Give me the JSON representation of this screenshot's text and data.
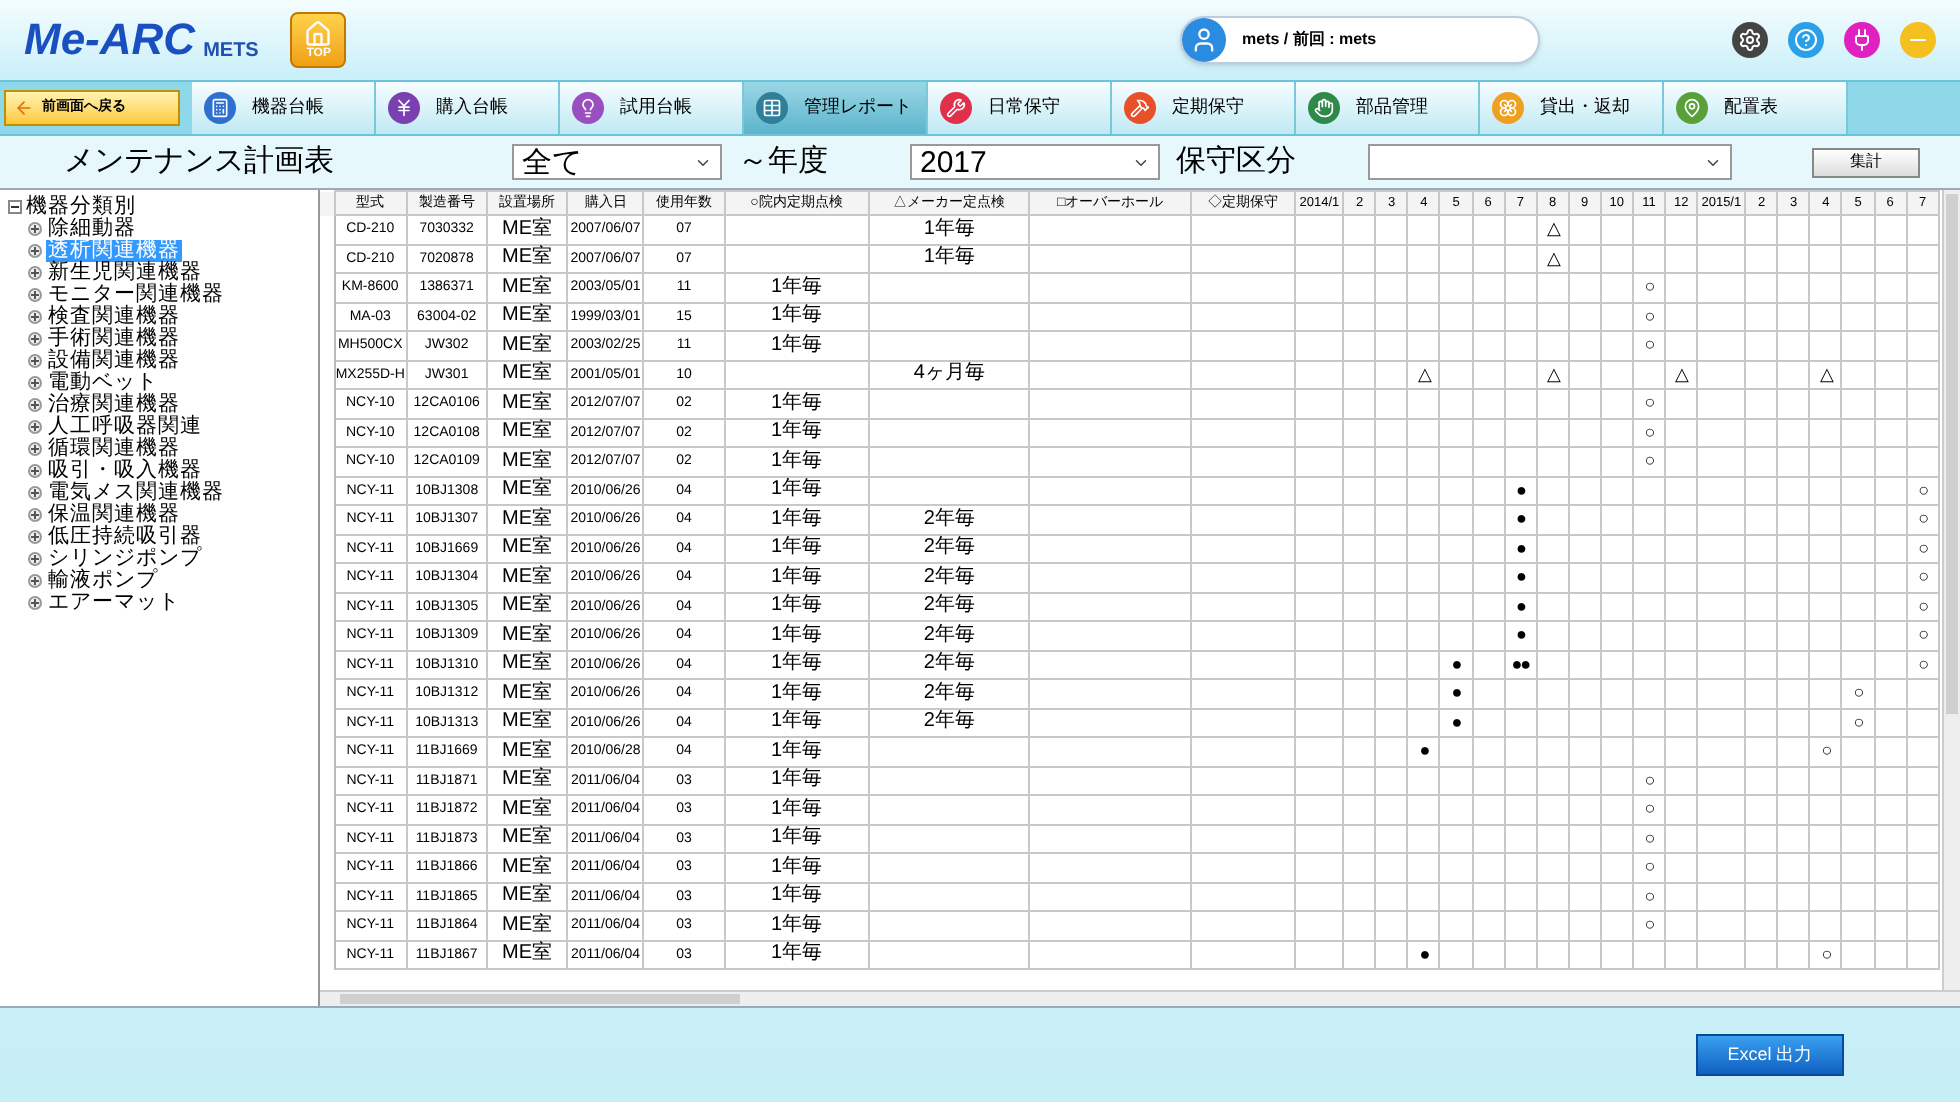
{
  "header": {
    "logo": "Me-ARC",
    "logo_sub": "METS",
    "top_button": "TOP",
    "user": "mets / 前回 : mets"
  },
  "nav": {
    "back": "前画面へ戻る",
    "tabs": [
      {
        "label": "機器台帳",
        "selected": false
      },
      {
        "label": "購入台帳",
        "selected": false
      },
      {
        "label": "試用台帳",
        "selected": false
      },
      {
        "label": "管理レポート",
        "selected": true
      },
      {
        "label": "日常保守",
        "selected": false
      },
      {
        "label": "定期保守",
        "selected": false
      },
      {
        "label": "部品管理",
        "selected": false
      },
      {
        "label": "貸出・返却",
        "selected": false
      },
      {
        "label": "配置表",
        "selected": false
      }
    ]
  },
  "toolbar": {
    "title": "メンテナンス計画表",
    "category": "全て",
    "year_suffix": "～年度",
    "year": "2017",
    "type_label": "保守区分",
    "run": "集計"
  },
  "tree": {
    "label": "機器分類別",
    "expanded": true,
    "children": [
      {
        "label": "除細動器",
        "selected": false
      },
      {
        "label": "透析関連機器",
        "selected": true
      },
      {
        "label": "新生児関連機器",
        "selected": false
      },
      {
        "label": "モニター関連機器",
        "selected": false
      },
      {
        "label": "検査関連機器",
        "selected": false
      },
      {
        "label": "手術関連機器",
        "selected": false
      },
      {
        "label": "設備関連機器",
        "selected": false
      },
      {
        "label": "電動ベット",
        "selected": false
      },
      {
        "label": "治療関連機器",
        "selected": false
      },
      {
        "label": "人工呼吸器関連",
        "selected": false
      },
      {
        "label": "循環関連機器",
        "selected": false
      },
      {
        "label": "吸引・吸入機器",
        "selected": false
      },
      {
        "label": "電気メス関連機器",
        "selected": false
      },
      {
        "label": "保温関連機器",
        "selected": false
      },
      {
        "label": "低圧持続吸引器",
        "selected": false
      },
      {
        "label": "シリンジポンプ",
        "selected": false
      },
      {
        "label": "輸液ポンプ",
        "selected": false
      },
      {
        "label": "エアーマット",
        "selected": false
      }
    ]
  },
  "table": {
    "columns": [
      "型式",
      "製造番号",
      "設置場所",
      "購入日",
      "使用年数",
      "○院内定期点検",
      "△メーカー定点検",
      "□オーバーホール",
      "◇定期保守"
    ],
    "months": [
      "2014/1",
      "2",
      "3",
      "4",
      "5",
      "6",
      "7",
      "8",
      "9",
      "10",
      "11",
      "12",
      "2015/1",
      "2",
      "3",
      "4",
      "5",
      "6",
      "7"
    ],
    "rows": [
      {
        "model": "CD-210",
        "serial": "7030332",
        "location": "ME室",
        "purchased": "2007/06/07",
        "years": "07",
        "maker": "1年毎",
        "months": [
          {
            "kind": "blank"
          },
          {
            "kind": "blank"
          },
          {
            "kind": "blank"
          },
          {
            "kind": "blank"
          },
          {
            "kind": "blank"
          },
          {
            "kind": "blank"
          },
          {
            "kind": "blank"
          },
          {
            "kind": "mark",
            "mark": "△"
          },
          {
            "kind": "blank"
          },
          {
            "kind": "blank"
          },
          {
            "kind": "blank"
          },
          {
            "kind": "blank"
          },
          {
            "kind": "blank"
          },
          {
            "kind": "blank"
          },
          {
            "kind": "blank"
          },
          {
            "kind": "blank"
          },
          {
            "kind": "blank"
          },
          {
            "kind": "blank"
          },
          {
            "kind": "blank"
          }
        ]
      },
      {
        "model": "CD-210",
        "serial": "7020878",
        "location": "ME室",
        "purchased": "2007/06/07",
        "years": "07",
        "maker": "1年毎",
        "months": [
          {
            "kind": "blank"
          },
          {
            "kind": "blank"
          },
          {
            "kind": "blank"
          },
          {
            "kind": "blank"
          },
          {
            "kind": "blank"
          },
          {
            "kind": "blank"
          },
          {
            "kind": "blank"
          },
          {
            "kind": "mark",
            "mark": "△"
          },
          {
            "kind": "blank"
          },
          {
            "kind": "blank"
          },
          {
            "kind": "blank"
          },
          {
            "kind": "blank"
          },
          {
            "kind": "blank"
          },
          {
            "kind": "blank"
          },
          {
            "kind": "blank"
          },
          {
            "kind": "blank"
          },
          {
            "kind": "blank"
          },
          {
            "kind": "blank"
          },
          {
            "kind": "blank"
          }
        ]
      },
      {
        "model": "KM-8600",
        "serial": "1386371",
        "location": "ME室",
        "purchased": "2003/05/01",
        "years": "11",
        "inhouse": "1年毎",
        "months": [
          {
            "kind": "blank"
          },
          {
            "kind": "blank"
          },
          {
            "kind": "blank"
          },
          {
            "kind": "blank"
          },
          {
            "kind": "blank"
          },
          {
            "kind": "blank"
          },
          {
            "kind": "blank"
          },
          {
            "kind": "blank"
          },
          {
            "kind": "blank"
          },
          {
            "kind": "blank"
          },
          {
            "kind": "mark",
            "mark": "○"
          },
          {
            "kind": "blank"
          },
          {
            "kind": "blank"
          },
          {
            "kind": "blank"
          },
          {
            "kind": "blank"
          },
          {
            "kind": "blank"
          },
          {
            "kind": "blank"
          },
          {
            "kind": "blank"
          },
          {
            "kind": "blank"
          }
        ]
      },
      {
        "model": "MA-03",
        "serial": "63004-02",
        "location": "ME室",
        "purchased": "1999/03/01",
        "years": "15",
        "inhouse": "1年毎",
        "months": [
          {
            "kind": "blank"
          },
          {
            "kind": "blank"
          },
          {
            "kind": "blank"
          },
          {
            "kind": "blank"
          },
          {
            "kind": "blank"
          },
          {
            "kind": "blank"
          },
          {
            "kind": "blank"
          },
          {
            "kind": "blank"
          },
          {
            "kind": "blank"
          },
          {
            "kind": "blank"
          },
          {
            "kind": "mark",
            "mark": "○"
          },
          {
            "kind": "blank"
          },
          {
            "kind": "blank"
          },
          {
            "kind": "blank"
          },
          {
            "kind": "blank"
          },
          {
            "kind": "blank"
          },
          {
            "kind": "blank"
          },
          {
            "kind": "blank"
          },
          {
            "kind": "blank"
          }
        ]
      },
      {
        "model": "MH500CX",
        "serial": "JW302",
        "location": "ME室",
        "purchased": "2003/02/25",
        "years": "11",
        "inhouse": "1年毎",
        "months": [
          {
            "kind": "blank"
          },
          {
            "kind": "blank"
          },
          {
            "kind": "blank"
          },
          {
            "kind": "blank"
          },
          {
            "kind": "blank"
          },
          {
            "kind": "blank"
          },
          {
            "kind": "blank"
          },
          {
            "kind": "blank"
          },
          {
            "kind": "blank"
          },
          {
            "kind": "blank"
          },
          {
            "kind": "mark",
            "mark": "○"
          },
          {
            "kind": "blank"
          },
          {
            "kind": "blank"
          },
          {
            "kind": "blank"
          },
          {
            "kind": "blank"
          },
          {
            "kind": "blank"
          },
          {
            "kind": "blank"
          },
          {
            "kind": "blank"
          },
          {
            "kind": "blank"
          }
        ]
      },
      {
        "model": "MX255D-H",
        "serial": "JW301",
        "location": "ME室",
        "purchased": "2001/05/01",
        "years": "10",
        "maker": "4ヶ月毎",
        "months": [
          {
            "kind": "blank"
          },
          {
            "kind": "blank"
          },
          {
            "kind": "blank"
          },
          {
            "kind": "mark",
            "mark": "△"
          },
          {
            "kind": "blank"
          },
          {
            "kind": "blank"
          },
          {
            "kind": "blank"
          },
          {
            "kind": "mark",
            "mark": "△"
          },
          {
            "kind": "blank"
          },
          {
            "kind": "blank"
          },
          {
            "kind": "blank"
          },
          {
            "kind": "mark",
            "mark": "△"
          },
          {
            "kind": "blank"
          },
          {
            "kind": "blank"
          },
          {
            "kind": "blank"
          },
          {
            "kind": "mark",
            "mark": "△"
          },
          {
            "kind": "blank"
          },
          {
            "kind": "blank"
          },
          {
            "kind": "blank"
          }
        ]
      },
      {
        "model": "NCY-10",
        "serial": "12CA0106",
        "location": "ME室",
        "purchased": "2012/07/07",
        "years": "02",
        "inhouse": "1年毎",
        "months": [
          {
            "kind": "blank"
          },
          {
            "kind": "blank"
          },
          {
            "kind": "blank"
          },
          {
            "kind": "blank"
          },
          {
            "kind": "blank"
          },
          {
            "kind": "blank"
          },
          {
            "kind": "blank"
          },
          {
            "kind": "blank"
          },
          {
            "kind": "blank"
          },
          {
            "kind": "blank"
          },
          {
            "kind": "mark",
            "mark": "○"
          },
          {
            "kind": "blank"
          },
          {
            "kind": "blank"
          },
          {
            "kind": "blank"
          },
          {
            "kind": "blank"
          },
          {
            "kind": "blank"
          },
          {
            "kind": "blank"
          },
          {
            "kind": "blank"
          },
          {
            "kind": "blank"
          }
        ]
      },
      {
        "model": "NCY-10",
        "serial": "12CA0108",
        "location": "ME室",
        "purchased": "2012/07/07",
        "years": "02",
        "inhouse": "1年毎",
        "months": [
          {
            "kind": "blank"
          },
          {
            "kind": "blank"
          },
          {
            "kind": "blank"
          },
          {
            "kind": "blank"
          },
          {
            "kind": "blank"
          },
          {
            "kind": "blank"
          },
          {
            "kind": "blank"
          },
          {
            "kind": "blank"
          },
          {
            "kind": "blank"
          },
          {
            "kind": "blank"
          },
          {
            "kind": "mark",
            "mark": "○"
          },
          {
            "kind": "blank"
          },
          {
            "kind": "blank"
          },
          {
            "kind": "blank"
          },
          {
            "kind": "blank"
          },
          {
            "kind": "blank"
          },
          {
            "kind": "blank"
          },
          {
            "kind": "blank"
          },
          {
            "kind": "blank"
          }
        ]
      },
      {
        "model": "NCY-10",
        "serial": "12CA0109",
        "location": "ME室",
        "purchased": "2012/07/07",
        "years": "02",
        "inhouse": "1年毎",
        "months": [
          {
            "kind": "blank"
          },
          {
            "kind": "blank"
          },
          {
            "kind": "blank"
          },
          {
            "kind": "blank"
          },
          {
            "kind": "blank"
          },
          {
            "kind": "blank"
          },
          {
            "kind": "blank"
          },
          {
            "kind": "blank"
          },
          {
            "kind": "blank"
          },
          {
            "kind": "blank"
          },
          {
            "kind": "mark",
            "mark": "○"
          },
          {
            "kind": "blank"
          },
          {
            "kind": "blank"
          },
          {
            "kind": "blank"
          },
          {
            "kind": "blank"
          },
          {
            "kind": "blank"
          },
          {
            "kind": "blank"
          },
          {
            "kind": "blank"
          },
          {
            "kind": "blank"
          }
        ]
      },
      {
        "model": "NCY-11",
        "serial": "10BJ1308",
        "location": "ME室",
        "purchased": "2010/06/26",
        "years": "04",
        "inhouse": "1年毎",
        "months": [
          {
            "kind": "blank"
          },
          {
            "kind": "blank"
          },
          {
            "kind": "blank"
          },
          {
            "kind": "blank"
          },
          {
            "kind": "blank"
          },
          {
            "kind": "blank"
          },
          {
            "kind": "mark",
            "mark": "●"
          },
          {
            "kind": "blank"
          },
          {
            "kind": "blank"
          },
          {
            "kind": "blank"
          },
          {
            "kind": "blank"
          },
          {
            "kind": "blank"
          },
          {
            "kind": "blank"
          },
          {
            "kind": "blank"
          },
          {
            "kind": "blank"
          },
          {
            "kind": "blank"
          },
          {
            "kind": "blank"
          },
          {
            "kind": "blank"
          },
          {
            "kind": "mark",
            "mark": "○"
          }
        ]
      },
      {
        "model": "NCY-11",
        "serial": "10BJ1307",
        "location": "ME室",
        "purchased": "2010/06/26",
        "years": "04",
        "inhouse": "1年毎",
        "maker": "2年毎",
        "months": [
          {
            "kind": "blank"
          },
          {
            "kind": "blank"
          },
          {
            "kind": "blank"
          },
          {
            "kind": "blank"
          },
          {
            "kind": "blank"
          },
          {
            "kind": "blank"
          },
          {
            "kind": "mark",
            "mark": "●"
          },
          {
            "kind": "blank"
          },
          {
            "kind": "blank"
          },
          {
            "kind": "blank"
          },
          {
            "kind": "blank"
          },
          {
            "kind": "blank"
          },
          {
            "kind": "blank"
          },
          {
            "kind": "blank"
          },
          {
            "kind": "blank"
          },
          {
            "kind": "blank"
          },
          {
            "kind": "blank"
          },
          {
            "kind": "blank"
          },
          {
            "kind": "mark",
            "mark": "○"
          }
        ]
      },
      {
        "model": "NCY-11",
        "serial": "10BJ1669",
        "location": "ME室",
        "purchased": "2010/06/26",
        "years": "04",
        "inhouse": "1年毎",
        "maker": "2年毎",
        "months": [
          {
            "kind": "blank"
          },
          {
            "kind": "blank"
          },
          {
            "kind": "blank"
          },
          {
            "kind": "blank"
          },
          {
            "kind": "blank"
          },
          {
            "kind": "blank"
          },
          {
            "kind": "mark",
            "mark": "●"
          },
          {
            "kind": "blank"
          },
          {
            "kind": "blank"
          },
          {
            "kind": "blank"
          },
          {
            "kind": "blank"
          },
          {
            "kind": "blank"
          },
          {
            "kind": "blank"
          },
          {
            "kind": "blank"
          },
          {
            "kind": "blank"
          },
          {
            "kind": "blank"
          },
          {
            "kind": "blank"
          },
          {
            "kind": "blank"
          },
          {
            "kind": "mark",
            "mark": "○"
          }
        ]
      },
      {
        "model": "NCY-11",
        "serial": "10BJ1304",
        "location": "ME室",
        "purchased": "2010/06/26",
        "years": "04",
        "inhouse": "1年毎",
        "maker": "2年毎",
        "months": [
          {
            "kind": "blank"
          },
          {
            "kind": "blank"
          },
          {
            "kind": "blank"
          },
          {
            "kind": "blank"
          },
          {
            "kind": "blank"
          },
          {
            "kind": "blank"
          },
          {
            "kind": "mark",
            "mark": "●"
          },
          {
            "kind": "blank"
          },
          {
            "kind": "blank"
          },
          {
            "kind": "blank"
          },
          {
            "kind": "blank"
          },
          {
            "kind": "blank"
          },
          {
            "kind": "blank"
          },
          {
            "kind": "blank"
          },
          {
            "kind": "blank"
          },
          {
            "kind": "blank"
          },
          {
            "kind": "blank"
          },
          {
            "kind": "blank"
          },
          {
            "kind": "mark",
            "mark": "○"
          }
        ]
      },
      {
        "model": "NCY-11",
        "serial": "10BJ1305",
        "location": "ME室",
        "purchased": "2010/06/26",
        "years": "04",
        "inhouse": "1年毎",
        "maker": "2年毎",
        "months": [
          {
            "kind": "blank"
          },
          {
            "kind": "blank"
          },
          {
            "kind": "blank"
          },
          {
            "kind": "blank"
          },
          {
            "kind": "blank"
          },
          {
            "kind": "blank"
          },
          {
            "kind": "mark",
            "mark": "●"
          },
          {
            "kind": "blank"
          },
          {
            "kind": "blank"
          },
          {
            "kind": "blank"
          },
          {
            "kind": "blank"
          },
          {
            "kind": "blank"
          },
          {
            "kind": "blank"
          },
          {
            "kind": "blank"
          },
          {
            "kind": "blank"
          },
          {
            "kind": "blank"
          },
          {
            "kind": "blank"
          },
          {
            "kind": "blank"
          },
          {
            "kind": "mark",
            "mark": "○"
          }
        ]
      },
      {
        "model": "NCY-11",
        "serial": "10BJ1309",
        "location": "ME室",
        "purchased": "2010/06/26",
        "years": "04",
        "inhouse": "1年毎",
        "maker": "2年毎",
        "months": [
          {
            "kind": "blank"
          },
          {
            "kind": "blank"
          },
          {
            "kind": "blank"
          },
          {
            "kind": "blank"
          },
          {
            "kind": "blank"
          },
          {
            "kind": "blank"
          },
          {
            "kind": "mark",
            "mark": "●"
          },
          {
            "kind": "blank"
          },
          {
            "kind": "blank"
          },
          {
            "kind": "blank"
          },
          {
            "kind": "blank"
          },
          {
            "kind": "blank"
          },
          {
            "kind": "blank"
          },
          {
            "kind": "blank"
          },
          {
            "kind": "blank"
          },
          {
            "kind": "blank"
          },
          {
            "kind": "blank"
          },
          {
            "kind": "blank"
          },
          {
            "kind": "mark",
            "mark": "○"
          }
        ]
      },
      {
        "model": "NCY-11",
        "serial": "10BJ1310",
        "location": "ME室",
        "purchased": "2010/06/26",
        "years": "04",
        "inhouse": "1年毎",
        "maker": "2年毎",
        "months": [
          {
            "kind": "blank"
          },
          {
            "kind": "blank"
          },
          {
            "kind": "blank"
          },
          {
            "kind": "blank"
          },
          {
            "kind": "mark",
            "mark": "●"
          },
          {
            "kind": "blank"
          },
          {
            "kind": "mark",
            "mark": "●●"
          },
          {
            "kind": "blank"
          },
          {
            "kind": "blank"
          },
          {
            "kind": "blank"
          },
          {
            "kind": "blank"
          },
          {
            "kind": "blank"
          },
          {
            "kind": "blank"
          },
          {
            "kind": "blank"
          },
          {
            "kind": "blank"
          },
          {
            "kind": "blank"
          },
          {
            "kind": "blank"
          },
          {
            "kind": "blank"
          },
          {
            "kind": "mark",
            "mark": "○"
          }
        ]
      },
      {
        "model": "NCY-11",
        "serial": "10BJ1312",
        "location": "ME室",
        "purchased": "2010/06/26",
        "years": "04",
        "inhouse": "1年毎",
        "maker": "2年毎",
        "months": [
          {
            "kind": "blank"
          },
          {
            "kind": "blank"
          },
          {
            "kind": "blank"
          },
          {
            "kind": "blank"
          },
          {
            "kind": "mark",
            "mark": "●"
          },
          {
            "kind": "blank"
          },
          {
            "kind": "blank"
          },
          {
            "kind": "blank"
          },
          {
            "kind": "blank"
          },
          {
            "kind": "blank"
          },
          {
            "kind": "blank"
          },
          {
            "kind": "blank"
          },
          {
            "kind": "blank"
          },
          {
            "kind": "blank"
          },
          {
            "kind": "blank"
          },
          {
            "kind": "blank"
          },
          {
            "kind": "mark",
            "mark": "○"
          },
          {
            "kind": "blank"
          },
          {
            "kind": "blank"
          }
        ]
      },
      {
        "model": "NCY-11",
        "serial": "10BJ1313",
        "location": "ME室",
        "purchased": "2010/06/26",
        "years": "04",
        "inhouse": "1年毎",
        "maker": "2年毎",
        "months": [
          {
            "kind": "blank"
          },
          {
            "kind": "blank"
          },
          {
            "kind": "blank"
          },
          {
            "kind": "blank"
          },
          {
            "kind": "mark",
            "mark": "●"
          },
          {
            "kind": "blank"
          },
          {
            "kind": "blank"
          },
          {
            "kind": "blank"
          },
          {
            "kind": "blank"
          },
          {
            "kind": "blank"
          },
          {
            "kind": "blank"
          },
          {
            "kind": "blank"
          },
          {
            "kind": "blank"
          },
          {
            "kind": "blank"
          },
          {
            "kind": "blank"
          },
          {
            "kind": "blank"
          },
          {
            "kind": "mark",
            "mark": "○"
          },
          {
            "kind": "blank"
          },
          {
            "kind": "blank"
          }
        ]
      },
      {
        "model": "NCY-11",
        "serial": "11BJ1669",
        "location": "ME室",
        "purchased": "2010/06/28",
        "years": "04",
        "inhouse": "1年毎",
        "months": [
          {
            "kind": "blank"
          },
          {
            "kind": "blank"
          },
          {
            "kind": "blank"
          },
          {
            "kind": "mark",
            "mark": "●"
          },
          {
            "kind": "blank"
          },
          {
            "kind": "blank"
          },
          {
            "kind": "blank"
          },
          {
            "kind": "blank"
          },
          {
            "kind": "blank"
          },
          {
            "kind": "blank"
          },
          {
            "kind": "blank"
          },
          {
            "kind": "blank"
          },
          {
            "kind": "blank"
          },
          {
            "kind": "blank"
          },
          {
            "kind": "blank"
          },
          {
            "kind": "mark",
            "mark": "○"
          },
          {
            "kind": "blank"
          },
          {
            "kind": "blank"
          },
          {
            "kind": "blank"
          }
        ]
      },
      {
        "model": "NCY-11",
        "serial": "11BJ1871",
        "location": "ME室",
        "purchased": "2011/06/04",
        "years": "03",
        "inhouse": "1年毎",
        "months": [
          {
            "kind": "blank"
          },
          {
            "kind": "blank"
          },
          {
            "kind": "blank"
          },
          {
            "kind": "blank"
          },
          {
            "kind": "blank"
          },
          {
            "kind": "blank"
          },
          {
            "kind": "blank"
          },
          {
            "kind": "blank"
          },
          {
            "kind": "blank"
          },
          {
            "kind": "blank"
          },
          {
            "kind": "mark",
            "mark": "○"
          },
          {
            "kind": "blank"
          },
          {
            "kind": "blank"
          },
          {
            "kind": "blank"
          },
          {
            "kind": "blank"
          },
          {
            "kind": "blank"
          },
          {
            "kind": "blank"
          },
          {
            "kind": "blank"
          },
          {
            "kind": "blank"
          }
        ]
      },
      {
        "model": "NCY-11",
        "serial": "11BJ1872",
        "location": "ME室",
        "purchased": "2011/06/04",
        "years": "03",
        "inhouse": "1年毎",
        "months": [
          {
            "kind": "blank"
          },
          {
            "kind": "blank"
          },
          {
            "kind": "blank"
          },
          {
            "kind": "blank"
          },
          {
            "kind": "blank"
          },
          {
            "kind": "blank"
          },
          {
            "kind": "blank"
          },
          {
            "kind": "blank"
          },
          {
            "kind": "blank"
          },
          {
            "kind": "blank"
          },
          {
            "kind": "mark",
            "mark": "○"
          },
          {
            "kind": "blank"
          },
          {
            "kind": "blank"
          },
          {
            "kind": "blank"
          },
          {
            "kind": "blank"
          },
          {
            "kind": "blank"
          },
          {
            "kind": "blank"
          },
          {
            "kind": "blank"
          },
          {
            "kind": "blank"
          }
        ]
      },
      {
        "model": "NCY-11",
        "serial": "11BJ1873",
        "location": "ME室",
        "purchased": "2011/06/04",
        "years": "03",
        "inhouse": "1年毎",
        "months": [
          {
            "kind": "blank"
          },
          {
            "kind": "blank"
          },
          {
            "kind": "blank"
          },
          {
            "kind": "blank"
          },
          {
            "kind": "blank"
          },
          {
            "kind": "blank"
          },
          {
            "kind": "blank"
          },
          {
            "kind": "blank"
          },
          {
            "kind": "blank"
          },
          {
            "kind": "blank"
          },
          {
            "kind": "mark",
            "mark": "○"
          },
          {
            "kind": "blank"
          },
          {
            "kind": "blank"
          },
          {
            "kind": "blank"
          },
          {
            "kind": "blank"
          },
          {
            "kind": "blank"
          },
          {
            "kind": "blank"
          },
          {
            "kind": "blank"
          },
          {
            "kind": "blank"
          }
        ]
      },
      {
        "model": "NCY-11",
        "serial": "11BJ1866",
        "location": "ME室",
        "purchased": "2011/06/04",
        "years": "03",
        "inhouse": "1年毎",
        "months": [
          {
            "kind": "blank"
          },
          {
            "kind": "blank"
          },
          {
            "kind": "blank"
          },
          {
            "kind": "blank"
          },
          {
            "kind": "blank"
          },
          {
            "kind": "blank"
          },
          {
            "kind": "blank"
          },
          {
            "kind": "blank"
          },
          {
            "kind": "blank"
          },
          {
            "kind": "blank"
          },
          {
            "kind": "mark",
            "mark": "○"
          },
          {
            "kind": "blank"
          },
          {
            "kind": "blank"
          },
          {
            "kind": "blank"
          },
          {
            "kind": "blank"
          },
          {
            "kind": "blank"
          },
          {
            "kind": "blank"
          },
          {
            "kind": "blank"
          },
          {
            "kind": "blank"
          }
        ]
      },
      {
        "model": "NCY-11",
        "serial": "11BJ1865",
        "location": "ME室",
        "purchased": "2011/06/04",
        "years": "03",
        "inhouse": "1年毎",
        "months": [
          {
            "kind": "blank"
          },
          {
            "kind": "blank"
          },
          {
            "kind": "blank"
          },
          {
            "kind": "blank"
          },
          {
            "kind": "blank"
          },
          {
            "kind": "blank"
          },
          {
            "kind": "blank"
          },
          {
            "kind": "blank"
          },
          {
            "kind": "blank"
          },
          {
            "kind": "blank"
          },
          {
            "kind": "mark",
            "mark": "○"
          },
          {
            "kind": "blank"
          },
          {
            "kind": "blank"
          },
          {
            "kind": "blank"
          },
          {
            "kind": "blank"
          },
          {
            "kind": "blank"
          },
          {
            "kind": "blank"
          },
          {
            "kind": "blank"
          },
          {
            "kind": "blank"
          }
        ]
      },
      {
        "model": "NCY-11",
        "serial": "11BJ1864",
        "location": "ME室",
        "purchased": "2011/06/04",
        "years": "03",
        "inhouse": "1年毎",
        "months": [
          {
            "kind": "blank"
          },
          {
            "kind": "blank"
          },
          {
            "kind": "blank"
          },
          {
            "kind": "blank"
          },
          {
            "kind": "blank"
          },
          {
            "kind": "blank"
          },
          {
            "kind": "blank"
          },
          {
            "kind": "blank"
          },
          {
            "kind": "blank"
          },
          {
            "kind": "blank"
          },
          {
            "kind": "mark",
            "mark": "○"
          },
          {
            "kind": "blank"
          },
          {
            "kind": "blank"
          },
          {
            "kind": "blank"
          },
          {
            "kind": "blank"
          },
          {
            "kind": "blank"
          },
          {
            "kind": "blank"
          },
          {
            "kind": "blank"
          },
          {
            "kind": "blank"
          }
        ]
      },
      {
        "model": "NCY-11",
        "serial": "11BJ1867",
        "location": "ME室",
        "purchased": "2011/06/04",
        "years": "03",
        "inhouse": "1年毎",
        "months": [
          {
            "kind": "blank"
          },
          {
            "kind": "blank"
          },
          {
            "kind": "blank"
          },
          {
            "kind": "mark",
            "mark": "●"
          },
          {
            "kind": "blank"
          },
          {
            "kind": "blank"
          },
          {
            "kind": "blank"
          },
          {
            "kind": "blank"
          },
          {
            "kind": "blank"
          },
          {
            "kind": "blank"
          },
          {
            "kind": "blank"
          },
          {
            "kind": "blank"
          },
          {
            "kind": "blank"
          },
          {
            "kind": "blank"
          },
          {
            "kind": "blank"
          },
          {
            "kind": "mark",
            "mark": "○"
          },
          {
            "kind": "blank"
          },
          {
            "kind": "blank"
          },
          {
            "kind": "blank"
          }
        ]
      }
    ]
  },
  "excel_button": "Excel 出力"
}
